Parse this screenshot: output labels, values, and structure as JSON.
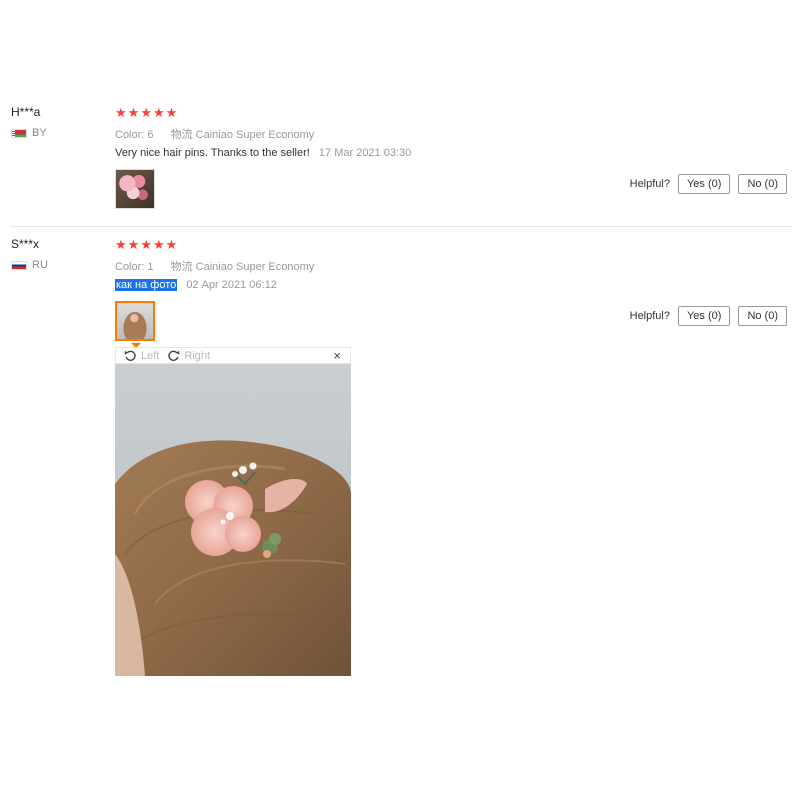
{
  "reviews": [
    {
      "user": "H***a",
      "country": "BY",
      "stars": [
        "★",
        "★",
        "★",
        "★",
        "★"
      ],
      "color_label": "Color:",
      "color_value": "6",
      "logistics_label": "物流",
      "logistics_value": "Cainiao Super Economy",
      "text": "Very nice hair pins. Thanks to the seller!",
      "date": "17 Mar 2021 03:30",
      "helpful_label": "Helpful?",
      "yes_label": "Yes (0)",
      "no_label": "No (0)"
    },
    {
      "user": "S***x",
      "country": "RU",
      "stars": [
        "★",
        "★",
        "★",
        "★",
        "★"
      ],
      "color_label": "Color:",
      "color_value": "1",
      "logistics_label": "物流",
      "logistics_value": "Cainiao Super Economy",
      "text": "как на фото",
      "date": "02 Apr 2021 06:12",
      "helpful_label": "Helpful?",
      "yes_label": "Yes (0)",
      "no_label": "No (0)"
    }
  ],
  "viewer": {
    "left_label": "Left",
    "right_label": "Right",
    "close_glyph": "×"
  },
  "colors": {
    "star": "#f44336",
    "selected_border": "#ff7a00",
    "highlight": "#1a73e8"
  }
}
